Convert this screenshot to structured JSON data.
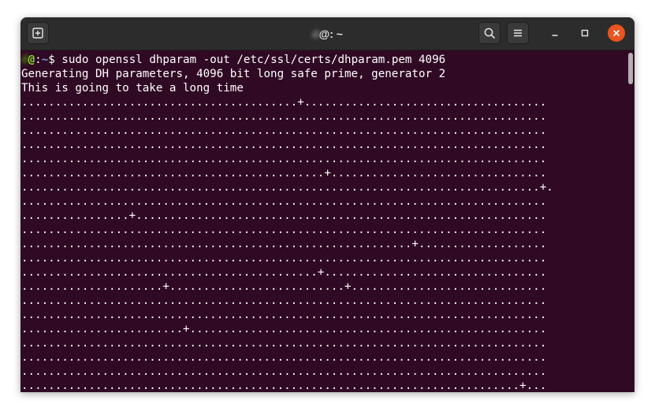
{
  "window": {
    "title_user": "d",
    "title_at": "@",
    "title_host": "",
    "title_suffix": ": ~"
  },
  "prompt": {
    "user": "d",
    "at": "@",
    "host": "",
    "path": "~",
    "symbol": "$",
    "command": "sudo openssl dhparam -out /etc/ssl/certs/dhparam.pem 4096"
  },
  "output": [
    "Generating DH parameters, 4096 bit long safe prime, generator 2",
    "This is going to take a long time",
    ".........................................+....................................",
    "..............................................................................",
    "..............................................................................",
    "..............................................................................",
    "..............................................................................",
    ".............................................+................................",
    ".............................................................................+.",
    "..............................................................................",
    "................+.............................................................",
    "..............................................................................",
    "..........................................................+...................",
    "..............................................................................",
    "............................................+.................................",
    ".....................+..........................+.............................",
    "..............................................................................",
    "..............................................................................",
    "........................+.....................................................",
    "..............................................................................",
    "..............................................................................",
    "..............................................................................",
    "..........................................................................+...",
    ".............................................................................."
  ],
  "icons": {
    "new_tab": "new-tab-icon",
    "search": "search-icon",
    "menu": "hamburger-menu-icon",
    "minimize": "minimize-icon",
    "maximize": "maximize-icon",
    "close": "close-icon"
  },
  "colors": {
    "terminal_bg": "#300a24",
    "titlebar_bg": "#2c2c2c",
    "prompt_user": "#8ae234",
    "prompt_path": "#729fcf",
    "close_button": "#e95420"
  }
}
